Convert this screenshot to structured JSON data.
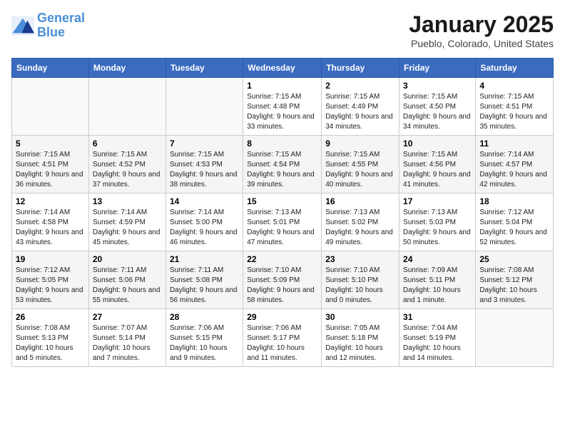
{
  "header": {
    "logo_line1": "General",
    "logo_line2": "Blue",
    "month": "January 2025",
    "location": "Pueblo, Colorado, United States"
  },
  "weekdays": [
    "Sunday",
    "Monday",
    "Tuesday",
    "Wednesday",
    "Thursday",
    "Friday",
    "Saturday"
  ],
  "weeks": [
    [
      {
        "day": "",
        "info": ""
      },
      {
        "day": "",
        "info": ""
      },
      {
        "day": "",
        "info": ""
      },
      {
        "day": "1",
        "info": "Sunrise: 7:15 AM\nSunset: 4:48 PM\nDaylight: 9 hours and 33 minutes."
      },
      {
        "day": "2",
        "info": "Sunrise: 7:15 AM\nSunset: 4:49 PM\nDaylight: 9 hours and 34 minutes."
      },
      {
        "day": "3",
        "info": "Sunrise: 7:15 AM\nSunset: 4:50 PM\nDaylight: 9 hours and 34 minutes."
      },
      {
        "day": "4",
        "info": "Sunrise: 7:15 AM\nSunset: 4:51 PM\nDaylight: 9 hours and 35 minutes."
      }
    ],
    [
      {
        "day": "5",
        "info": "Sunrise: 7:15 AM\nSunset: 4:51 PM\nDaylight: 9 hours and 36 minutes."
      },
      {
        "day": "6",
        "info": "Sunrise: 7:15 AM\nSunset: 4:52 PM\nDaylight: 9 hours and 37 minutes."
      },
      {
        "day": "7",
        "info": "Sunrise: 7:15 AM\nSunset: 4:53 PM\nDaylight: 9 hours and 38 minutes."
      },
      {
        "day": "8",
        "info": "Sunrise: 7:15 AM\nSunset: 4:54 PM\nDaylight: 9 hours and 39 minutes."
      },
      {
        "day": "9",
        "info": "Sunrise: 7:15 AM\nSunset: 4:55 PM\nDaylight: 9 hours and 40 minutes."
      },
      {
        "day": "10",
        "info": "Sunrise: 7:15 AM\nSunset: 4:56 PM\nDaylight: 9 hours and 41 minutes."
      },
      {
        "day": "11",
        "info": "Sunrise: 7:14 AM\nSunset: 4:57 PM\nDaylight: 9 hours and 42 minutes."
      }
    ],
    [
      {
        "day": "12",
        "info": "Sunrise: 7:14 AM\nSunset: 4:58 PM\nDaylight: 9 hours and 43 minutes."
      },
      {
        "day": "13",
        "info": "Sunrise: 7:14 AM\nSunset: 4:59 PM\nDaylight: 9 hours and 45 minutes."
      },
      {
        "day": "14",
        "info": "Sunrise: 7:14 AM\nSunset: 5:00 PM\nDaylight: 9 hours and 46 minutes."
      },
      {
        "day": "15",
        "info": "Sunrise: 7:13 AM\nSunset: 5:01 PM\nDaylight: 9 hours and 47 minutes."
      },
      {
        "day": "16",
        "info": "Sunrise: 7:13 AM\nSunset: 5:02 PM\nDaylight: 9 hours and 49 minutes."
      },
      {
        "day": "17",
        "info": "Sunrise: 7:13 AM\nSunset: 5:03 PM\nDaylight: 9 hours and 50 minutes."
      },
      {
        "day": "18",
        "info": "Sunrise: 7:12 AM\nSunset: 5:04 PM\nDaylight: 9 hours and 52 minutes."
      }
    ],
    [
      {
        "day": "19",
        "info": "Sunrise: 7:12 AM\nSunset: 5:05 PM\nDaylight: 9 hours and 53 minutes."
      },
      {
        "day": "20",
        "info": "Sunrise: 7:11 AM\nSunset: 5:06 PM\nDaylight: 9 hours and 55 minutes."
      },
      {
        "day": "21",
        "info": "Sunrise: 7:11 AM\nSunset: 5:08 PM\nDaylight: 9 hours and 56 minutes."
      },
      {
        "day": "22",
        "info": "Sunrise: 7:10 AM\nSunset: 5:09 PM\nDaylight: 9 hours and 58 minutes."
      },
      {
        "day": "23",
        "info": "Sunrise: 7:10 AM\nSunset: 5:10 PM\nDaylight: 10 hours and 0 minutes."
      },
      {
        "day": "24",
        "info": "Sunrise: 7:09 AM\nSunset: 5:11 PM\nDaylight: 10 hours and 1 minute."
      },
      {
        "day": "25",
        "info": "Sunrise: 7:08 AM\nSunset: 5:12 PM\nDaylight: 10 hours and 3 minutes."
      }
    ],
    [
      {
        "day": "26",
        "info": "Sunrise: 7:08 AM\nSunset: 5:13 PM\nDaylight: 10 hours and 5 minutes."
      },
      {
        "day": "27",
        "info": "Sunrise: 7:07 AM\nSunset: 5:14 PM\nDaylight: 10 hours and 7 minutes."
      },
      {
        "day": "28",
        "info": "Sunrise: 7:06 AM\nSunset: 5:15 PM\nDaylight: 10 hours and 9 minutes."
      },
      {
        "day": "29",
        "info": "Sunrise: 7:06 AM\nSunset: 5:17 PM\nDaylight: 10 hours and 11 minutes."
      },
      {
        "day": "30",
        "info": "Sunrise: 7:05 AM\nSunset: 5:18 PM\nDaylight: 10 hours and 12 minutes."
      },
      {
        "day": "31",
        "info": "Sunrise: 7:04 AM\nSunset: 5:19 PM\nDaylight: 10 hours and 14 minutes."
      },
      {
        "day": "",
        "info": ""
      }
    ]
  ]
}
